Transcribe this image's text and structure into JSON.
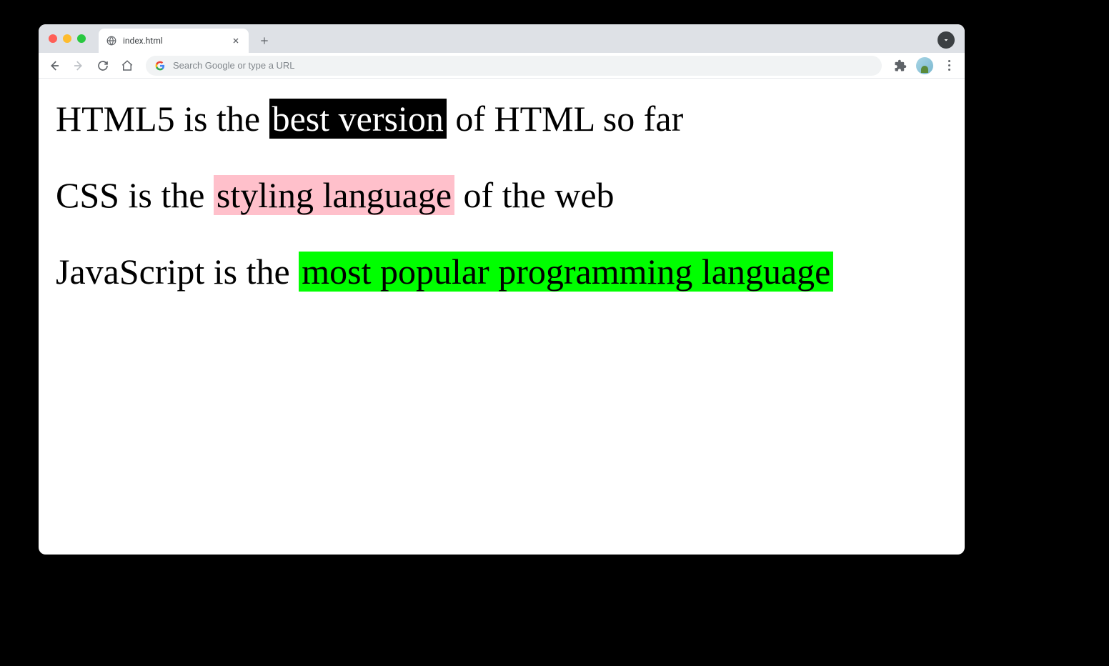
{
  "browser": {
    "tab": {
      "title": "index.html"
    },
    "omnibox": {
      "placeholder": "Search Google or type a URL"
    }
  },
  "page": {
    "line1": {
      "before": "HTML5 is the ",
      "highlight": "best version",
      "after": " of HTML so far"
    },
    "line2": {
      "before": "CSS is the ",
      "highlight": "styling language",
      "after": " of the web"
    },
    "line3": {
      "before": "JavaScript is the ",
      "highlight": "most popular programming language",
      "after": ""
    }
  },
  "colors": {
    "highlight_black_bg": "#000000",
    "highlight_black_fg": "#ffffff",
    "highlight_pink_bg": "#ffc0cb",
    "highlight_green_bg": "#00ff00"
  }
}
